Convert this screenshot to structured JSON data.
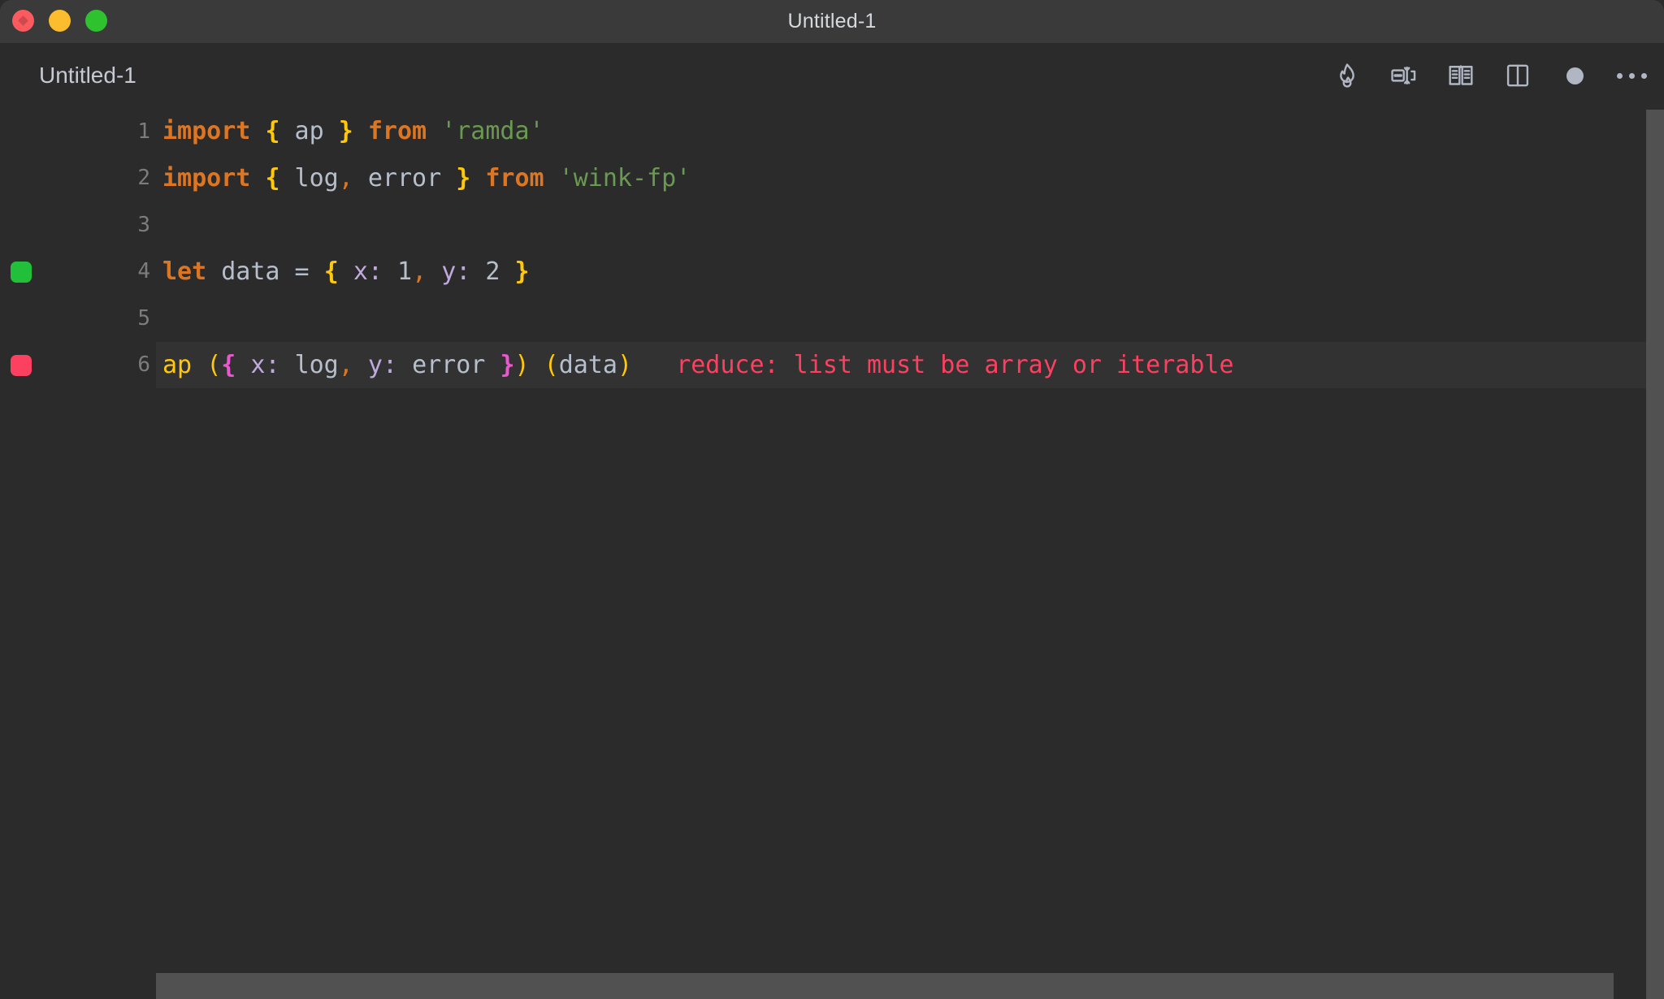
{
  "window": {
    "title": "Untitled-1",
    "traffic_lights": [
      {
        "name": "close",
        "color": "#fb5a5f"
      },
      {
        "name": "minimize",
        "color": "#fbbd2e"
      },
      {
        "name": "maximize",
        "color": "#2fc22f"
      }
    ]
  },
  "tab": {
    "label": "Untitled-1"
  },
  "toolbar": {
    "items": [
      {
        "icon": "flame-icon",
        "label": "Run / Quokka"
      },
      {
        "icon": "format-text-icon",
        "label": "Format Document"
      },
      {
        "icon": "open-book-icon",
        "label": "Open Preview"
      },
      {
        "icon": "split-editor-icon",
        "label": "Split Editor"
      },
      {
        "icon": "unsaved-dot-icon",
        "label": "Unsaved Changes"
      },
      {
        "icon": "ellipsis-icon",
        "label": "More Actions"
      }
    ]
  },
  "editor": {
    "gutter_markers": {
      "ok_color": "#22c03a",
      "error_color": "#fb4060"
    },
    "lines": [
      {
        "number": "1",
        "marker": null,
        "active": false,
        "tokens": [
          {
            "text": "import",
            "type": "kw"
          },
          {
            "text": " ",
            "type": "plain"
          },
          {
            "text": "{",
            "type": "brace"
          },
          {
            "text": " ap ",
            "type": "ident"
          },
          {
            "text": "}",
            "type": "brace"
          },
          {
            "text": " ",
            "type": "plain"
          },
          {
            "text": "from",
            "type": "kw"
          },
          {
            "text": " ",
            "type": "plain"
          },
          {
            "text": "'ramda'",
            "type": "string"
          }
        ]
      },
      {
        "number": "2",
        "marker": null,
        "active": false,
        "tokens": [
          {
            "text": "import",
            "type": "kw"
          },
          {
            "text": " ",
            "type": "plain"
          },
          {
            "text": "{",
            "type": "brace"
          },
          {
            "text": " log",
            "type": "ident"
          },
          {
            "text": ",",
            "type": "punct"
          },
          {
            "text": " error ",
            "type": "ident"
          },
          {
            "text": "}",
            "type": "brace"
          },
          {
            "text": " ",
            "type": "plain"
          },
          {
            "text": "from",
            "type": "kw"
          },
          {
            "text": " ",
            "type": "plain"
          },
          {
            "text": "'wink-fp'",
            "type": "string"
          }
        ]
      },
      {
        "number": "3",
        "marker": null,
        "active": false,
        "tokens": []
      },
      {
        "number": "4",
        "marker": "ok",
        "active": false,
        "tokens": [
          {
            "text": "let",
            "type": "kw"
          },
          {
            "text": " ",
            "type": "plain"
          },
          {
            "text": "data",
            "type": "ident"
          },
          {
            "text": " = ",
            "type": "ident"
          },
          {
            "text": "{",
            "type": "brace"
          },
          {
            "text": " ",
            "type": "plain"
          },
          {
            "text": "x",
            "type": "prop"
          },
          {
            "text": ": ",
            "type": "prop"
          },
          {
            "text": "1",
            "type": "num"
          },
          {
            "text": ",",
            "type": "punct"
          },
          {
            "text": " ",
            "type": "plain"
          },
          {
            "text": "y",
            "type": "prop"
          },
          {
            "text": ": ",
            "type": "prop"
          },
          {
            "text": "2",
            "type": "num"
          },
          {
            "text": " ",
            "type": "plain"
          },
          {
            "text": "}",
            "type": "brace"
          }
        ]
      },
      {
        "number": "5",
        "marker": null,
        "active": false,
        "tokens": []
      },
      {
        "number": "6",
        "marker": "error",
        "active": true,
        "tokens": [
          {
            "text": "ap",
            "type": "fn"
          },
          {
            "text": " ",
            "type": "plain"
          },
          {
            "text": "(",
            "type": "paren"
          },
          {
            "text": "{",
            "type": "brace2"
          },
          {
            "text": " ",
            "type": "plain"
          },
          {
            "text": "x",
            "type": "prop"
          },
          {
            "text": ": ",
            "type": "prop"
          },
          {
            "text": "log",
            "type": "ident"
          },
          {
            "text": ",",
            "type": "punct"
          },
          {
            "text": " ",
            "type": "plain"
          },
          {
            "text": "y",
            "type": "prop"
          },
          {
            "text": ": ",
            "type": "prop"
          },
          {
            "text": "error",
            "type": "ident"
          },
          {
            "text": " ",
            "type": "plain"
          },
          {
            "text": "}",
            "type": "brace2"
          },
          {
            "text": ")",
            "type": "paren"
          },
          {
            "text": " ",
            "type": "plain"
          },
          {
            "text": "(",
            "type": "paren"
          },
          {
            "text": "data",
            "type": "ident"
          },
          {
            "text": ")",
            "type": "paren"
          },
          {
            "text": "   ",
            "type": "plain"
          },
          {
            "text": "reduce: list must be array or iterable",
            "type": "error"
          }
        ]
      }
    ]
  },
  "scrollbars": {
    "vertical_color": "#515151",
    "horizontal_color": "#515151"
  }
}
